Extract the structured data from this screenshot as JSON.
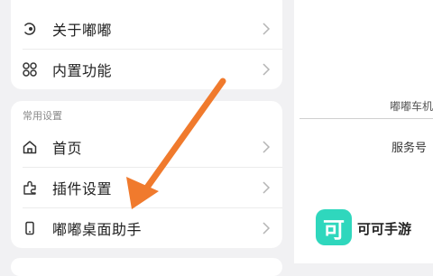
{
  "settings": {
    "top_items": [
      {
        "label": "关于嘟嘟",
        "icon": "about-icon"
      },
      {
        "label": "内置功能",
        "icon": "grid-icon"
      }
    ],
    "common_section": {
      "title": "常用设置",
      "items": [
        {
          "label": "首页",
          "icon": "home-icon"
        },
        {
          "label": "插件设置",
          "icon": "plugin-icon"
        },
        {
          "label": "嘟嘟桌面助手",
          "icon": "phone-icon"
        }
      ]
    }
  },
  "right_panel": {
    "caption": "嘟嘟车机",
    "service_label": "服务号",
    "app": {
      "icon_glyph": "可",
      "name": "可可手游",
      "color": "#2fd7bd"
    }
  },
  "annotation": {
    "arrow_color": "#f07a2d"
  }
}
